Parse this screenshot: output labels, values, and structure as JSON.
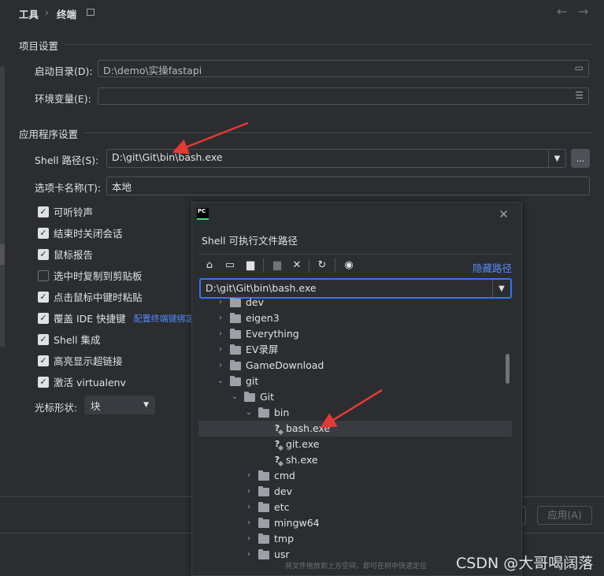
{
  "header": {
    "crumb1": "工具",
    "separator": "›",
    "crumb2": "终端",
    "nav_back_icon": "arrow-left",
    "nav_forward_icon": "arrow-right"
  },
  "project_settings": {
    "title": "项目设置",
    "start_dir_label": "启动目录(D):",
    "start_dir_value": "D:\\demo\\实操fastapi",
    "env_label": "环境变量(E):",
    "env_value": ""
  },
  "app_settings": {
    "title": "应用程序设置",
    "shell_label": "Shell 路径(S):",
    "shell_value": "D:\\git\\Git\\bin\\bash.exe",
    "shell_more": "...",
    "tab_label": "选项卡名称(T):",
    "tab_value": "本地",
    "checkboxes": [
      {
        "label": "可听铃声",
        "checked": true
      },
      {
        "label": "结束时关闭会话",
        "checked": true
      },
      {
        "label": "鼠标报告",
        "checked": true
      },
      {
        "label": "选中时复制到剪贴板",
        "checked": false
      },
      {
        "label": "点击鼠标中键时粘贴",
        "checked": true
      },
      {
        "label": "覆盖 IDE 快捷键",
        "checked": true,
        "link": "配置终端键绑定"
      },
      {
        "label": "Shell 集成",
        "checked": true
      },
      {
        "label": "高亮显示超链接",
        "checked": true
      },
      {
        "label": "激活 virtualenv",
        "checked": true
      }
    ],
    "cursor_label": "光标形状:",
    "cursor_value": "块"
  },
  "footer": {
    "apply_label": "应用(A)"
  },
  "dialog": {
    "title": "Shell 可执行文件路径",
    "hide_path": "隐藏路径",
    "path_value": "D:\\git\\Git\\bin\\bash.exe",
    "hint": "将文件拖放到上方空间，即可在树中快速定位",
    "toolbar_icons": [
      "home-icon",
      "desktop-icon",
      "project-folder-icon",
      "new-folder-icon",
      "delete-icon",
      "refresh-icon",
      "show-hidden-icon"
    ],
    "tree": [
      {
        "label": "dev",
        "depth": 0,
        "kind": "folder",
        "chev": "›"
      },
      {
        "label": "eigen3",
        "depth": 0,
        "kind": "folder",
        "chev": "›"
      },
      {
        "label": "Everything",
        "depth": 0,
        "kind": "folder",
        "chev": "›"
      },
      {
        "label": "EV录屏",
        "depth": 0,
        "kind": "folder",
        "chev": "›"
      },
      {
        "label": "GameDownload",
        "depth": 0,
        "kind": "folder",
        "chev": "›"
      },
      {
        "label": "git",
        "depth": 0,
        "kind": "folder",
        "chev": "⌄"
      },
      {
        "label": "Git",
        "depth": 1,
        "kind": "folder",
        "chev": "⌄"
      },
      {
        "label": "bin",
        "depth": 2,
        "kind": "folder",
        "chev": "⌄"
      },
      {
        "label": "bash.exe",
        "depth": 3,
        "kind": "file",
        "chev": "",
        "selected": true
      },
      {
        "label": "git.exe",
        "depth": 3,
        "kind": "file",
        "chev": ""
      },
      {
        "label": "sh.exe",
        "depth": 3,
        "kind": "file",
        "chev": ""
      },
      {
        "label": "cmd",
        "depth": 2,
        "kind": "folder",
        "chev": "›"
      },
      {
        "label": "dev",
        "depth": 2,
        "kind": "folder",
        "chev": "›"
      },
      {
        "label": "etc",
        "depth": 2,
        "kind": "folder",
        "chev": "›"
      },
      {
        "label": "mingw64",
        "depth": 2,
        "kind": "folder",
        "chev": "›"
      },
      {
        "label": "tmp",
        "depth": 2,
        "kind": "folder",
        "chev": "›"
      },
      {
        "label": "usr",
        "depth": 2,
        "kind": "folder",
        "chev": "›"
      }
    ]
  },
  "watermark": "CSDN @大哥喝阔落",
  "colors": {
    "accent": "#3574f0",
    "link": "#548af7",
    "annotation_arrow": "#e53935"
  }
}
